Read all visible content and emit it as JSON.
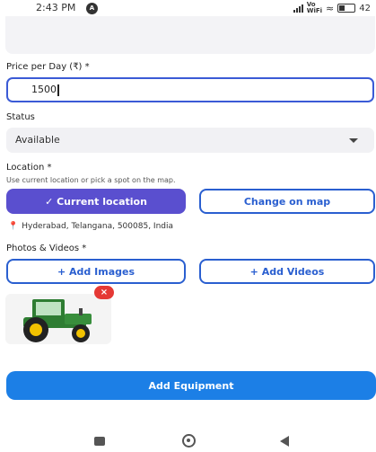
{
  "status_bar": {
    "time": "2:43 PM",
    "badge": "A",
    "volte": "Vo\nWiFi",
    "battery_text": "42"
  },
  "form": {
    "price": {
      "label": "Price per Day (₹) *",
      "value": "1500"
    },
    "status": {
      "label": "Status",
      "selected": "Available"
    },
    "location": {
      "label": "Location *",
      "hint": "Use current location or pick a spot on the map.",
      "current_button": "✓ Current location",
      "change_button": "Change on map",
      "address": "Hyderabad, Telangana, 500085, India"
    },
    "media": {
      "label": "Photos & Videos *",
      "add_images_button": "+ Add Images",
      "add_videos_button": "+ Add Videos",
      "remove_badge": "×"
    },
    "submit_button": "Add Equipment"
  },
  "colors": {
    "primary_blue": "#1c7fe6",
    "accent_purple": "#5a4fcf",
    "outline_blue": "#2a5fd0",
    "remove_red": "#e53935"
  },
  "icons": {
    "location_pin": "map-pin-icon",
    "remove": "close-icon",
    "nav_recents": "square-icon",
    "nav_home": "circle-icon",
    "nav_back": "triangle-back-icon"
  }
}
